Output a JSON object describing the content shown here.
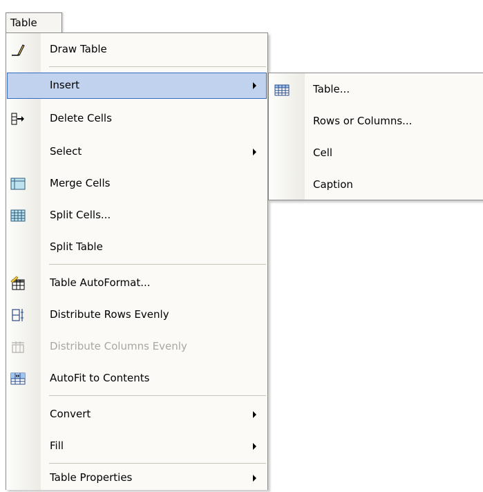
{
  "menu_title": "Table",
  "menu": {
    "items": [
      {
        "label": "Draw Table",
        "icon": "pencil-icon"
      },
      {
        "label": "Insert",
        "icon": "",
        "submenu": true,
        "highlighted": true
      },
      {
        "label": "Delete Cells",
        "icon": "delete-cells-icon"
      },
      {
        "label": "Select",
        "icon": "",
        "submenu": true
      },
      {
        "label": "Merge Cells",
        "icon": "merge-cells-icon"
      },
      {
        "label": "Split Cells...",
        "icon": "split-cells-icon"
      },
      {
        "label": "Split Table",
        "icon": ""
      },
      {
        "label": "Table AutoFormat...",
        "icon": "autoformat-icon"
      },
      {
        "label": "Distribute Rows Evenly",
        "icon": "distribute-rows-icon"
      },
      {
        "label": "Distribute Columns Evenly",
        "icon": "distribute-columns-icon",
        "disabled": true
      },
      {
        "label": "AutoFit to Contents",
        "icon": "autofit-icon"
      },
      {
        "label": "Convert",
        "icon": "",
        "submenu": true
      },
      {
        "label": "Fill",
        "icon": "",
        "submenu": true
      },
      {
        "label": "Table Properties",
        "icon": "",
        "submenu": true
      }
    ]
  },
  "submenu": {
    "items": [
      {
        "label": "Table...",
        "icon": "insert-table-icon"
      },
      {
        "label": "Rows or Columns...",
        "icon": ""
      },
      {
        "label": "Cell",
        "icon": ""
      },
      {
        "label": "Caption",
        "icon": ""
      }
    ]
  },
  "colors": {
    "highlight_fill": "#c1d2ee",
    "highlight_border": "#316ac5",
    "disabled_text": "#a9a79e"
  }
}
